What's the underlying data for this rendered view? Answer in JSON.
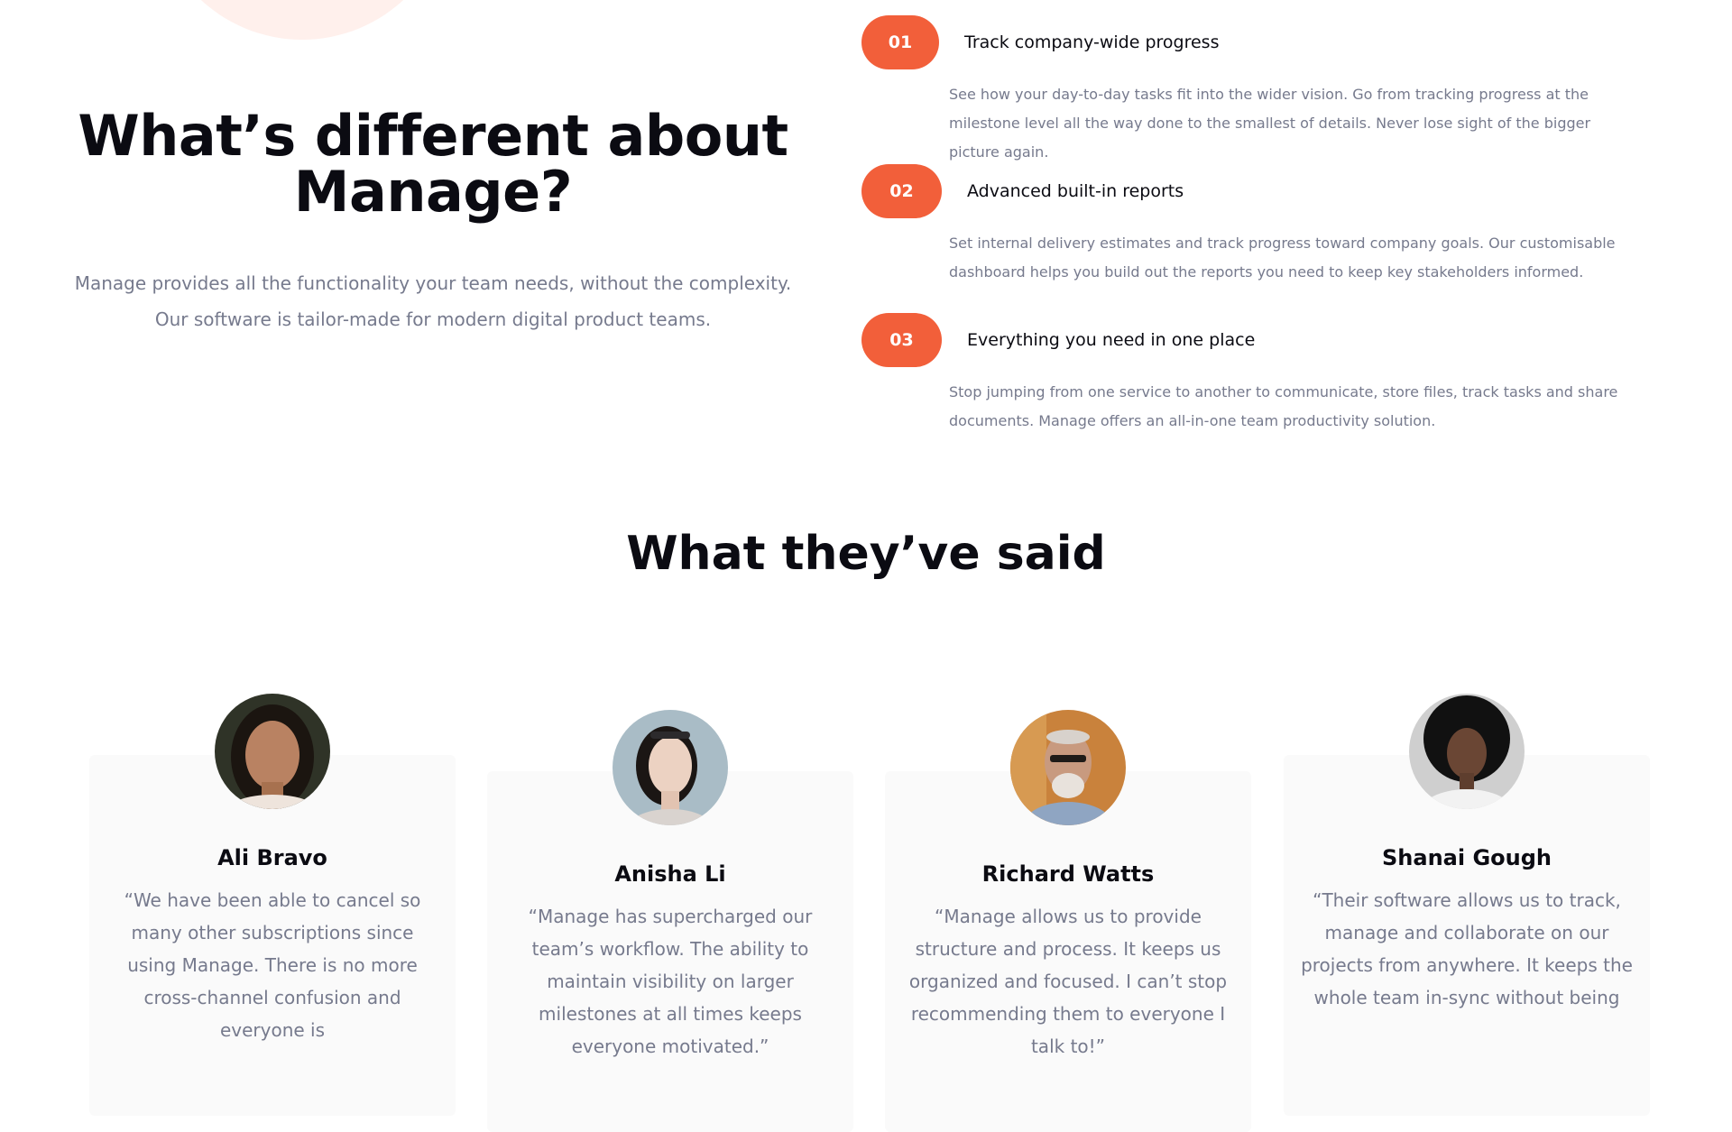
{
  "intro": {
    "title_line1": "What’s different about",
    "title_line2": "Manage?",
    "description_line1": "Manage provides all the functionality your team needs, without the complexity.",
    "description_line2": "Our software is tailor-made for modern digital product teams."
  },
  "features": [
    {
      "number": "01",
      "title": "Track company-wide progress",
      "body": "See how your day-to-day tasks fit into the wider vision. Go from tracking progress at the milestone level all the way done to the smallest of details. Never lose sight of the bigger picture again."
    },
    {
      "number": "02",
      "title": "Advanced built-in reports",
      "body": "Set internal delivery estimates and track progress toward company goals. Our customisable dashboard helps you build out the reports you need to keep key stakeholders informed."
    },
    {
      "number": "03",
      "title": "Everything you need in one place",
      "body": "Stop jumping from one service to another to communicate, store files, track tasks and share documents. Manage offers an all-in-one team productivity solution."
    }
  ],
  "testimonials": {
    "heading": "What they’ve said",
    "items": [
      {
        "name": "Ali Bravo",
        "quote": "“We have been able to cancel so many other subscriptions since using Manage. There is no more cross-channel confusion and everyone is"
      },
      {
        "name": "Anisha Li",
        "quote": "“Manage has supercharged our team’s workflow. The ability to maintain visibility on larger milestones at all times keeps everyone motivated.”"
      },
      {
        "name": "Richard Watts",
        "quote": "“Manage allows us to provide structure and process. It keeps us organized and focused. I can’t stop recommending them to everyone I talk to!”"
      },
      {
        "name": "Shanai Gough",
        "quote": "“Their software allows us to track, manage and collaborate on our projects from anywhere. It keeps the whole team in-sync without being"
      }
    ]
  },
  "colors": {
    "accent": "#F25F3A",
    "text_dark": "#0b0b12",
    "text_muted": "#767A8D",
    "card_bg": "#FAFAFA",
    "decor_circle": "#FFF0EC"
  }
}
